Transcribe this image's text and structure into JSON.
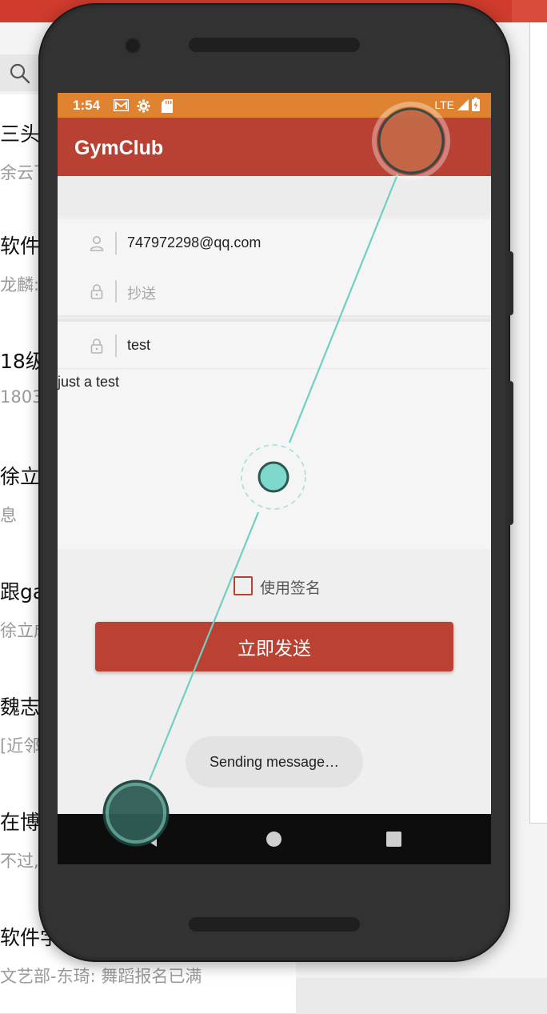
{
  "background_app": {
    "rows": [
      {
        "title": "三头",
        "subtitle": "余云飞"
      },
      {
        "title": "软件",
        "subtitle": "龙麟: "
      },
      {
        "title": "18级",
        "subtitle": "1803-"
      },
      {
        "title": "徐立",
        "subtitle": "息"
      },
      {
        "title": "跟gay",
        "subtitle": "徐立成"
      },
      {
        "title": "魏志",
        "subtitle": "[近邻"
      },
      {
        "title": "在博",
        "subtitle": "不过,"
      },
      {
        "title": "软件学",
        "subtitle": "文艺部-东琦: 舞蹈报名已满"
      }
    ]
  },
  "status_bar": {
    "time": "1:54",
    "network": "LTE"
  },
  "app_bar": {
    "title": "GymClub"
  },
  "compose": {
    "to": {
      "value": "747972298@qq.com",
      "icon": "person-icon"
    },
    "cc": {
      "placeholder": "抄送",
      "icon": "lock-icon"
    },
    "subject": {
      "value": "test",
      "icon": "lock-icon"
    },
    "body": "just a test",
    "signature_label": "使用签名",
    "signature_checked": false,
    "send_label": "立即发送"
  },
  "toast": {
    "message": "Sending message…"
  },
  "colors": {
    "status_bar": "#e08330",
    "app_bar": "#b94133",
    "accent": "#bb4133",
    "gesture_line": "#6fd0c2"
  }
}
